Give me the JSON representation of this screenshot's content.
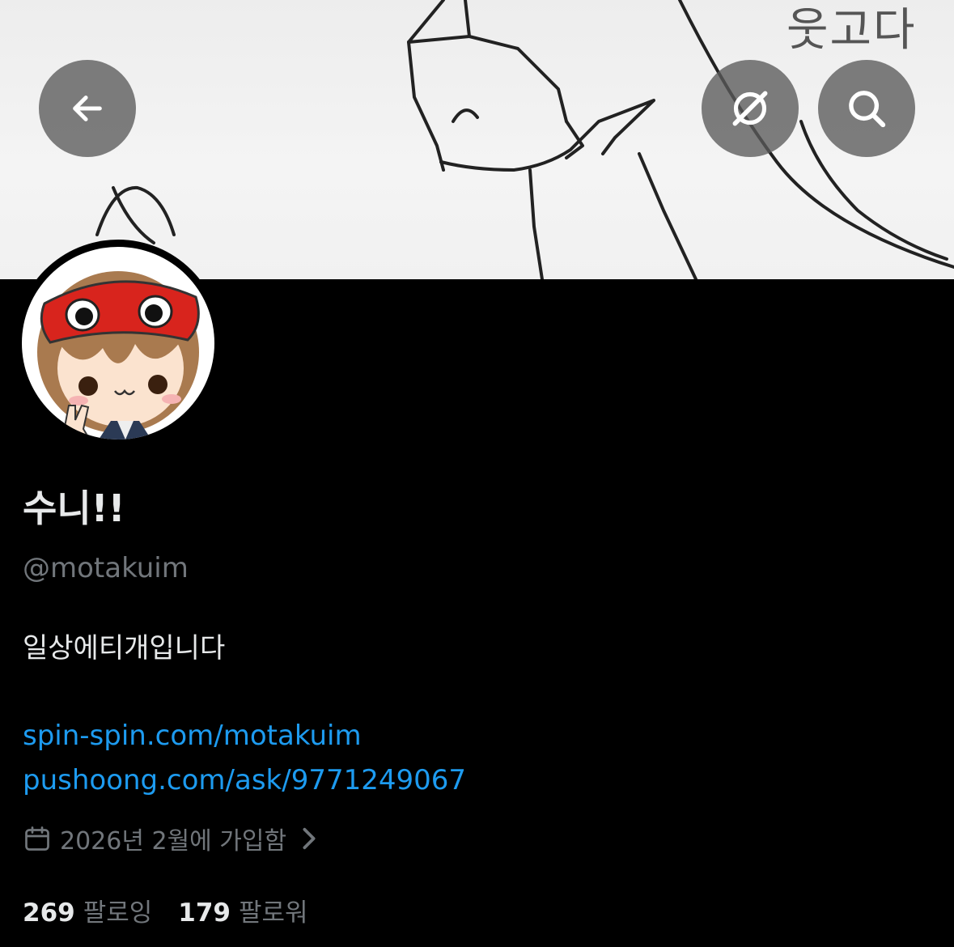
{
  "header": {
    "banner_text_line": "웃고다"
  },
  "profile": {
    "display_name": "수니!!",
    "handle": "@motakuim",
    "bio": "일상에티개입니다",
    "links": [
      "spin-spin.com/motakuim",
      "pushoong.com/ask/9771249067"
    ],
    "joined": "2026년 2월에 가입함",
    "following_count": "269",
    "following_label": "팔로잉",
    "followers_count": "179",
    "followers_label": "팔로워"
  },
  "icons": {
    "back": "arrow-left-icon",
    "grok": "grok-icon",
    "search": "search-icon",
    "calendar": "calendar-icon",
    "chevron": "chevron-right-icon"
  },
  "colors": {
    "background": "#000000",
    "link": "#1d9bf0",
    "secondary_text": "#71767b",
    "primary_text": "#e7e9ea"
  }
}
